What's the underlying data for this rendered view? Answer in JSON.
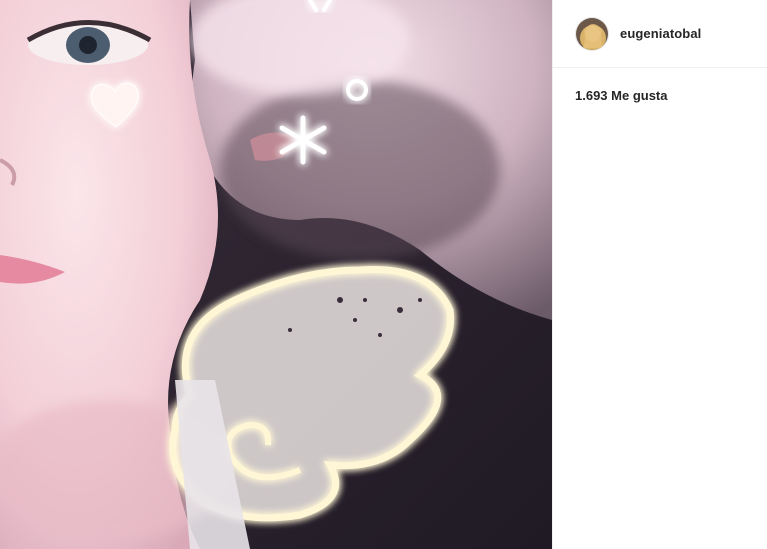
{
  "post": {
    "photo_label": "selfie-photo-with-angel-wing-filter",
    "username": "eugeniatobal",
    "likes_text": "1.693 Me gusta"
  },
  "icons": {
    "avatar": "profile-avatar",
    "heart": "heart-sticker-icon",
    "sparkle": "sparkle-sticker-icon",
    "wing": "angel-wing-sticker-icon"
  },
  "colors": {
    "text": "#262626",
    "divider": "#efefef",
    "glow": "#fff6d6"
  }
}
